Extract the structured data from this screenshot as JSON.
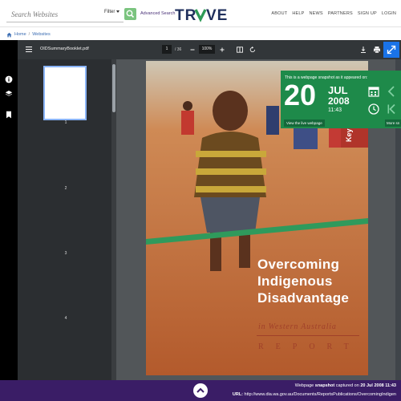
{
  "header": {
    "search_placeholder": "Search Websites",
    "filter_label": "Filter",
    "advanced_label": "Advanced Search",
    "logo_text": "TROVE",
    "nav": [
      "ABOUT",
      "HELP",
      "NEWS",
      "PARTNERS",
      "SIGN UP",
      "LOGIN"
    ]
  },
  "breadcrumb": {
    "home": "Home",
    "section": "Websites"
  },
  "viewer": {
    "file_name": "OIDSummaryBooklet.pdf",
    "page_current": "1",
    "page_total": "/ 36",
    "zoom": "100%",
    "thumbnails": [
      "1",
      "2",
      "3",
      "4"
    ]
  },
  "cover": {
    "title_lines": [
      "Overcoming",
      "Indigenous",
      "Disadvantage"
    ],
    "subtitle": "in Western Australia",
    "report": "REPORT",
    "side_tab": "Key"
  },
  "snapshot": {
    "note": "This is a webpage snapshot as it appeared on:",
    "day": "20",
    "month": "JUL",
    "year": "2008",
    "time": "11:43",
    "live_label": "View the live webpage",
    "more_label": "More sn"
  },
  "footer": {
    "line1_prefix": "Webpage",
    "line1_bold": "snapshot",
    "line1_mid": "captured on",
    "line1_date": "20 Jul 2008 11:43",
    "url_label": "URL:",
    "url": "http://www.dia.wa.gov.au/Documents/ReportsPublications/OvercomingIndigen"
  },
  "colors": {
    "brand_purple": "#3a1d66",
    "brand_green": "#1e8a4a",
    "search_green": "#7bc47f",
    "toolbar": "#323639",
    "cover_orange": "#c26a36"
  }
}
